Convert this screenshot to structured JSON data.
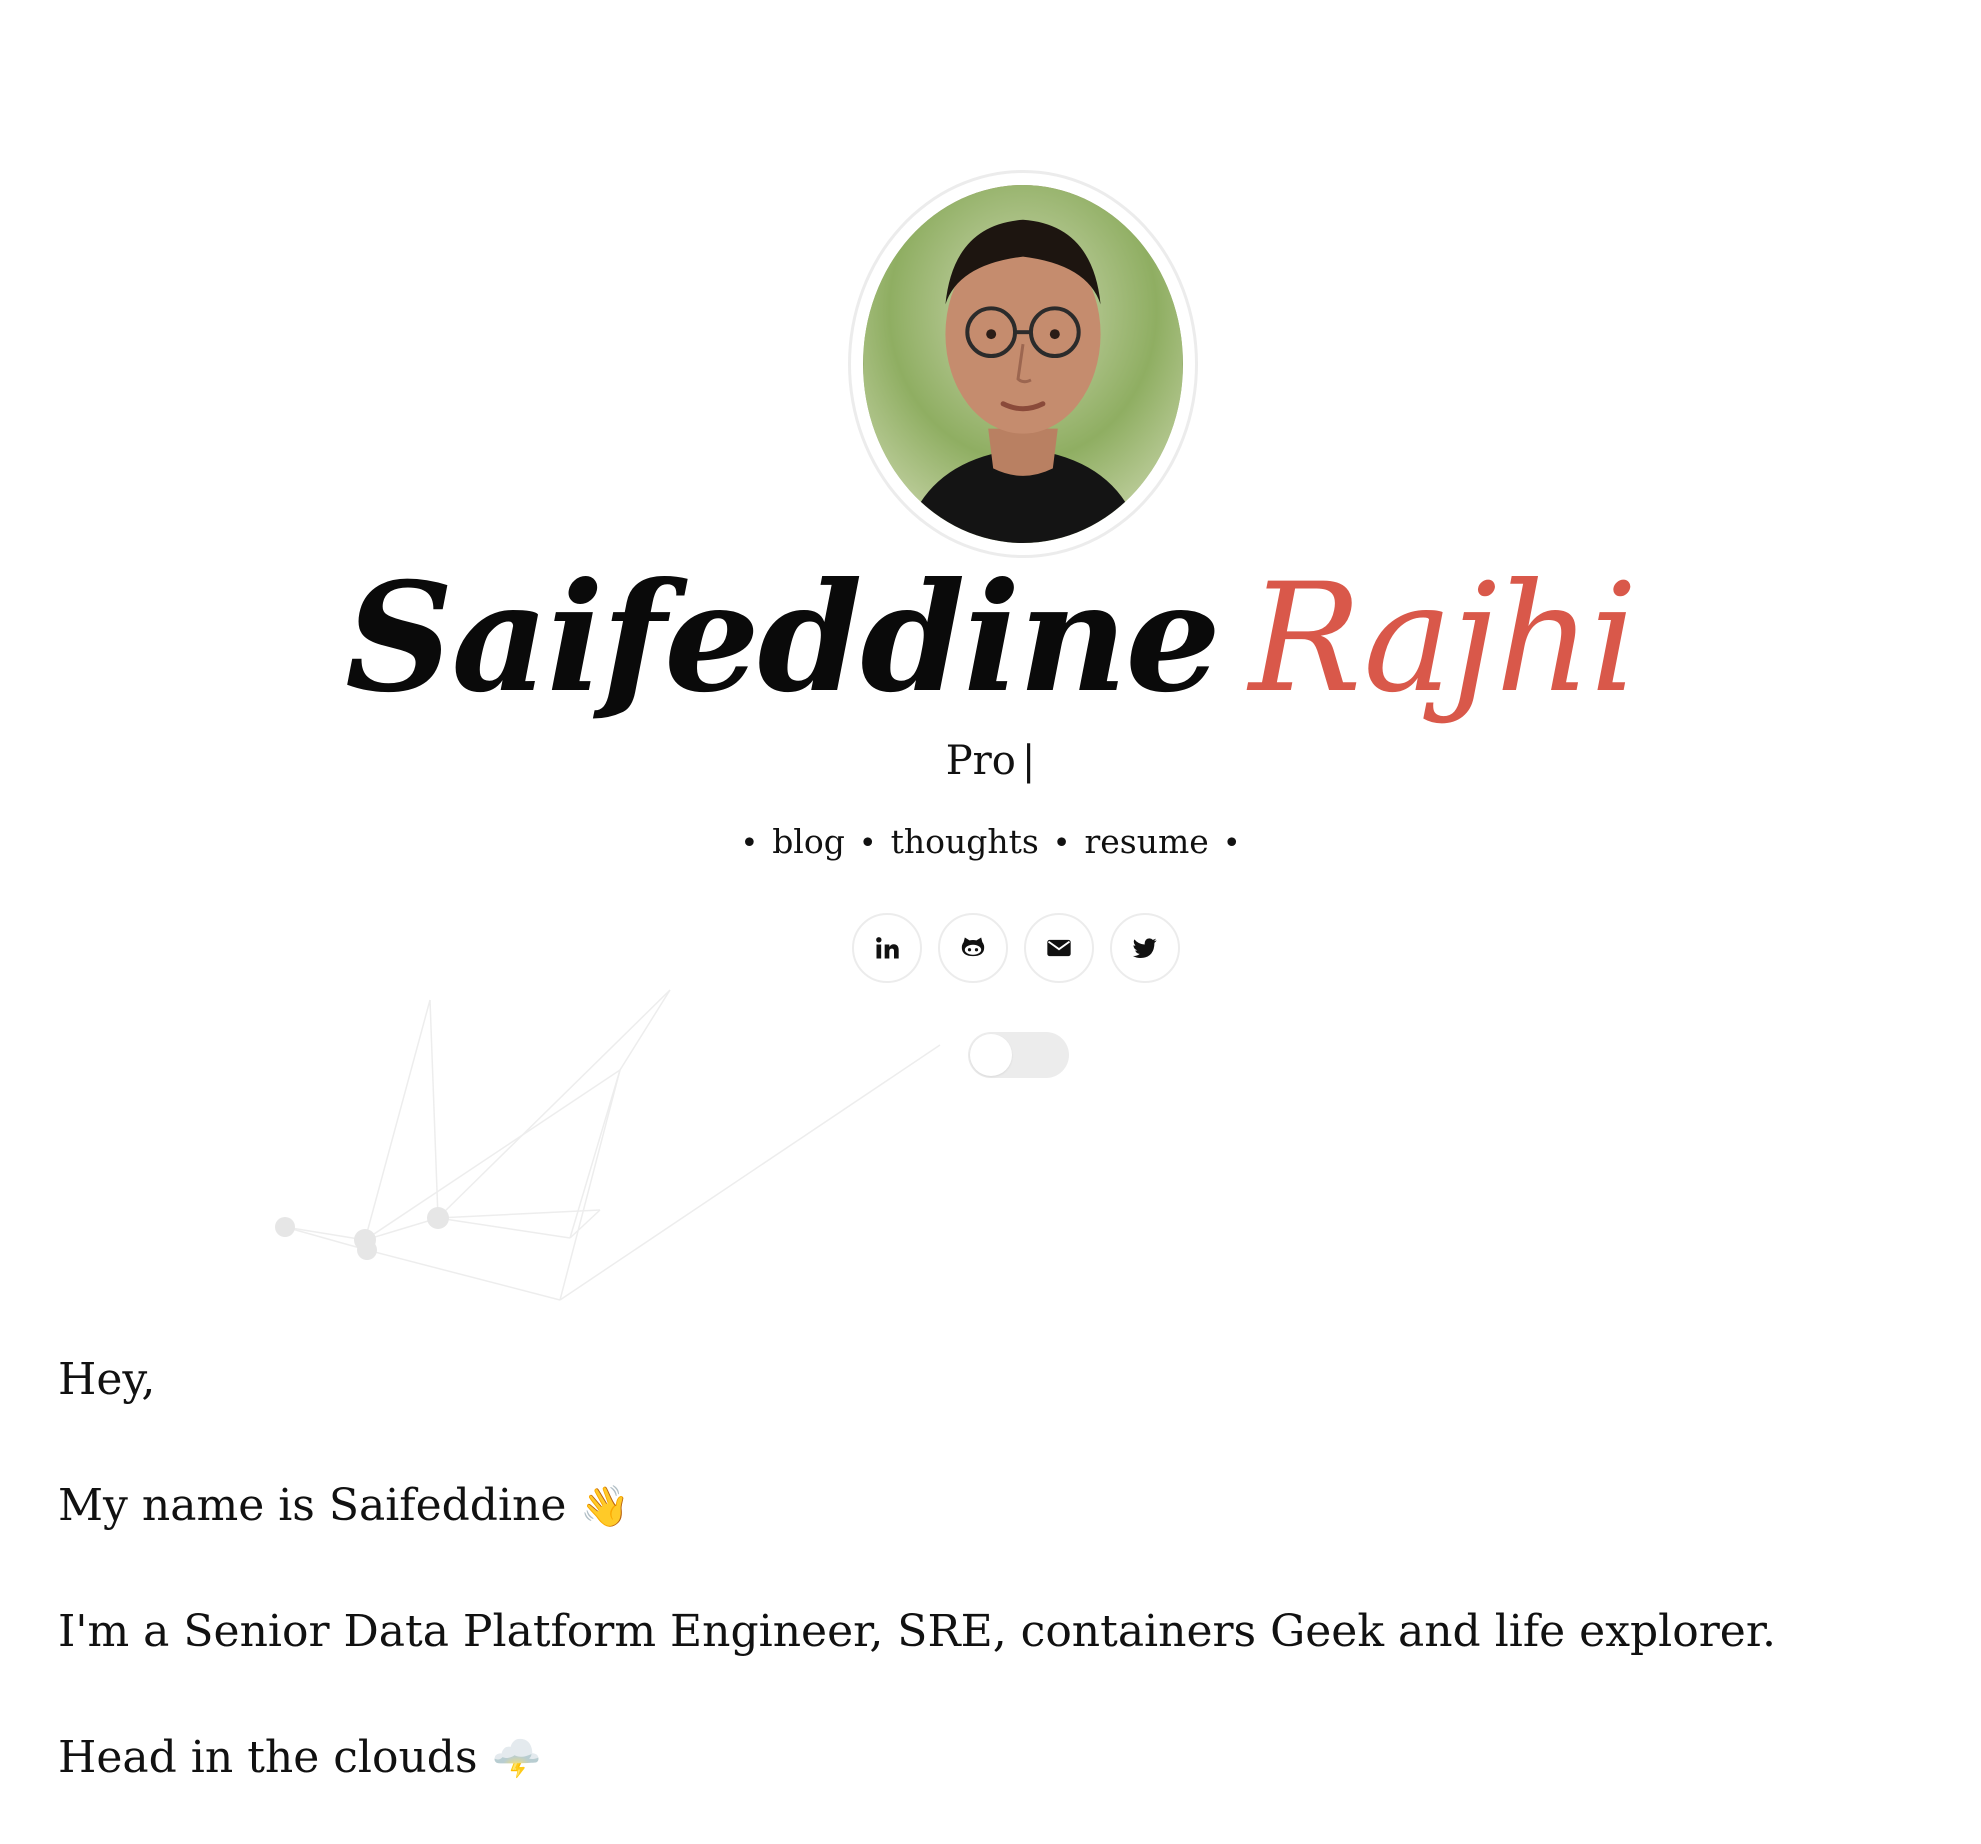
{
  "profile": {
    "first_name": "Saifeddine",
    "last_name": "Rajhi",
    "subtitle": "Pro",
    "cursor": "|",
    "accent_color": "#d9584a"
  },
  "nav": {
    "items": [
      {
        "label": "blog"
      },
      {
        "label": "thoughts"
      },
      {
        "label": "resume"
      }
    ],
    "separator": "•"
  },
  "socials": [
    {
      "icon": "linkedin-icon"
    },
    {
      "icon": "github-icon"
    },
    {
      "icon": "envelope-icon"
    },
    {
      "icon": "twitter-icon"
    }
  ],
  "theme_toggle": {
    "state": "off"
  },
  "intro": {
    "greeting": "Hey,",
    "name_line": "My name is Saifeddine",
    "name_emoji": "👋",
    "role_line": "I'm a Senior Data Platform Engineer, SRE, containers Geek and life explorer.",
    "clouds_line": "Head in the clouds",
    "clouds_emoji": "🌩️"
  }
}
